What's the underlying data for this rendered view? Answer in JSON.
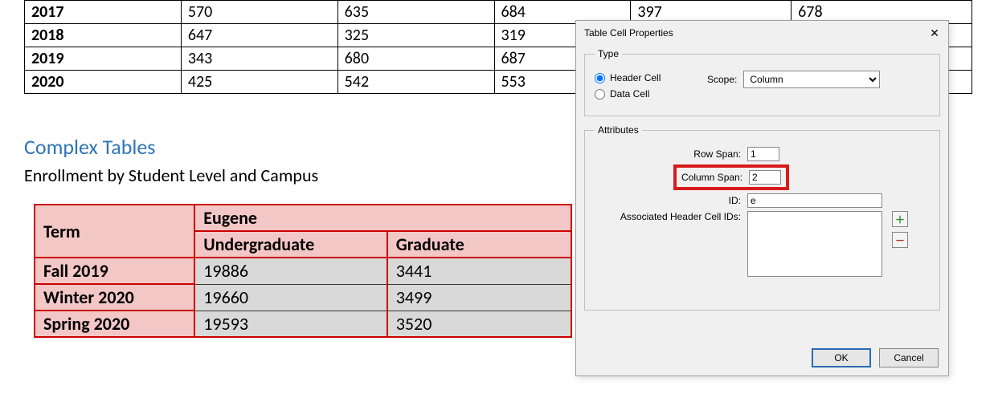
{
  "top_table": {
    "rows": [
      {
        "year": "2017",
        "c1": "570",
        "c2": "635",
        "c3": "684",
        "c4": "397",
        "c5": "678"
      },
      {
        "year": "2018",
        "c1": "647",
        "c2": "325",
        "c3": "319",
        "c4": "",
        "c5": ""
      },
      {
        "year": "2019",
        "c1": "343",
        "c2": "680",
        "c3": "687",
        "c4": "",
        "c5": ""
      },
      {
        "year": "2020",
        "c1": "425",
        "c2": "542",
        "c3": "553",
        "c4": "",
        "c5": ""
      }
    ]
  },
  "section": {
    "heading": "Complex Tables",
    "subtitle": "Enrollment by Student Level and Campus"
  },
  "complex_table": {
    "col_term": "Term",
    "col_campus": "Eugene",
    "sub1": "Undergraduate",
    "sub2": "Graduate",
    "rows": [
      {
        "term": "Fall 2019",
        "ug": "19886",
        "gr": "3441"
      },
      {
        "term": "Winter 2020",
        "ug": "19660",
        "gr": "3499"
      },
      {
        "term": "Spring 2020",
        "ug": "19593",
        "gr": "3520"
      }
    ]
  },
  "dialog": {
    "title": "Table Cell Properties",
    "group_type": "Type",
    "opt_header": "Header Cell",
    "opt_data": "Data Cell",
    "scope_label": "Scope:",
    "scope_value": "Column",
    "group_attr": "Attributes",
    "rowspan_label": "Row Span:",
    "rowspan_value": "1",
    "colspan_label": "Column Span:",
    "colspan_value": "2",
    "id_label": "ID:",
    "id_value": "e",
    "assoc_label": "Associated Header Cell IDs:",
    "ok": "OK",
    "cancel": "Cancel"
  }
}
